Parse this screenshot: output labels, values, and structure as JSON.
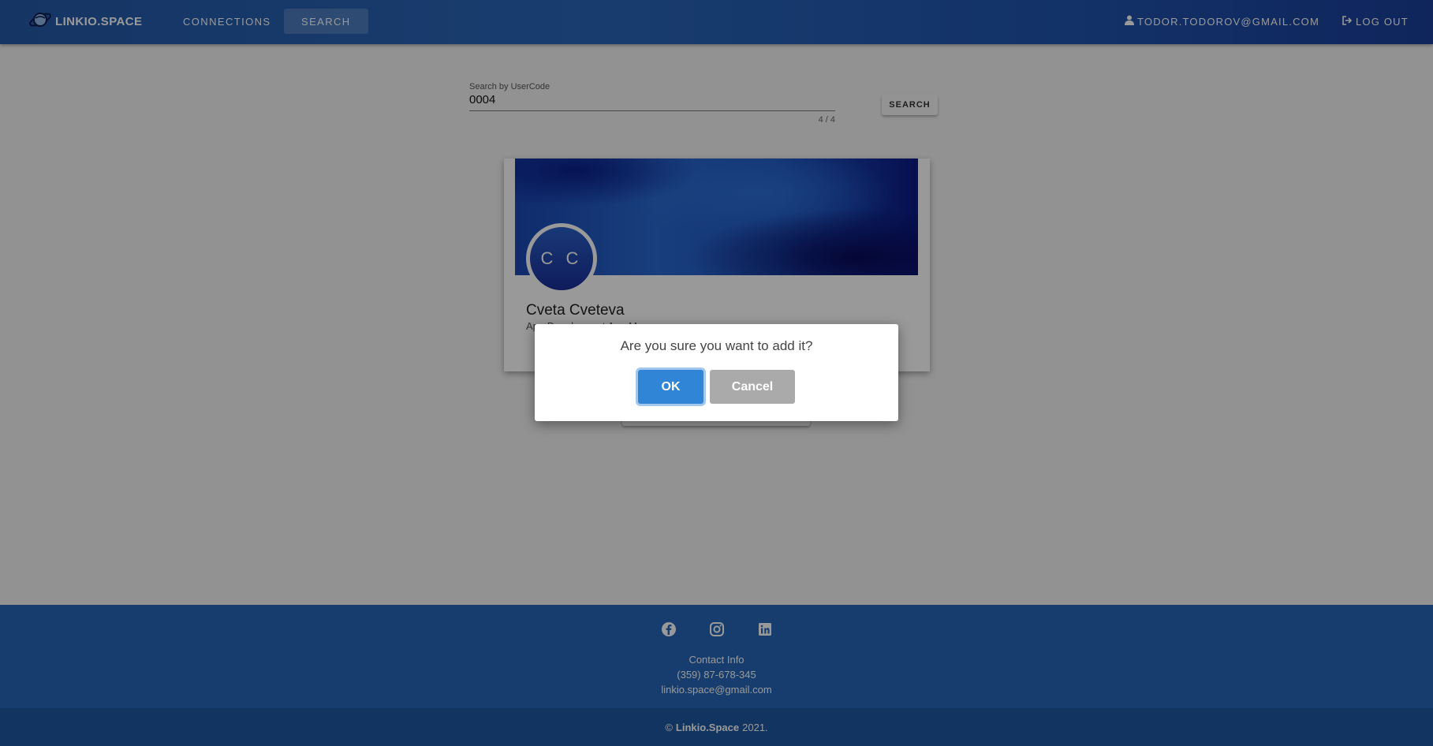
{
  "header": {
    "brand": "LINKIO.SPACE",
    "nav": [
      {
        "label": "CONNECTIONS"
      },
      {
        "label": "SEARCH"
      }
    ],
    "user_email": "TODOR.TODOROV@GMAIL.COM",
    "logout_label": "LOG OUT"
  },
  "search": {
    "label": "Search by UserCode",
    "value": "0004",
    "counter": "4 / 4",
    "button_label": "SEARCH"
  },
  "profile": {
    "initials": "C C",
    "name": "Cveta Cveteva",
    "title": "App Developer at App Ma..."
  },
  "dialog": {
    "message": "Are you sure you want to add it?",
    "ok_label": "OK",
    "cancel_label": "Cancel"
  },
  "footer": {
    "social_icons": [
      "facebook-icon",
      "instagram-icon",
      "linkedin-icon"
    ],
    "contact_title": "Contact Info",
    "phone": "(359) 87-678-345",
    "email": "linkio.space@gmail.com",
    "copyright_symbol": "©",
    "copyright_brand": "Linkio.Space",
    "copyright_year": "2021."
  },
  "colors": {
    "header": "#2a66b8",
    "footer": "#2667b6",
    "ok_button": "#3085d6",
    "cancel_button": "#aaaaaa"
  }
}
